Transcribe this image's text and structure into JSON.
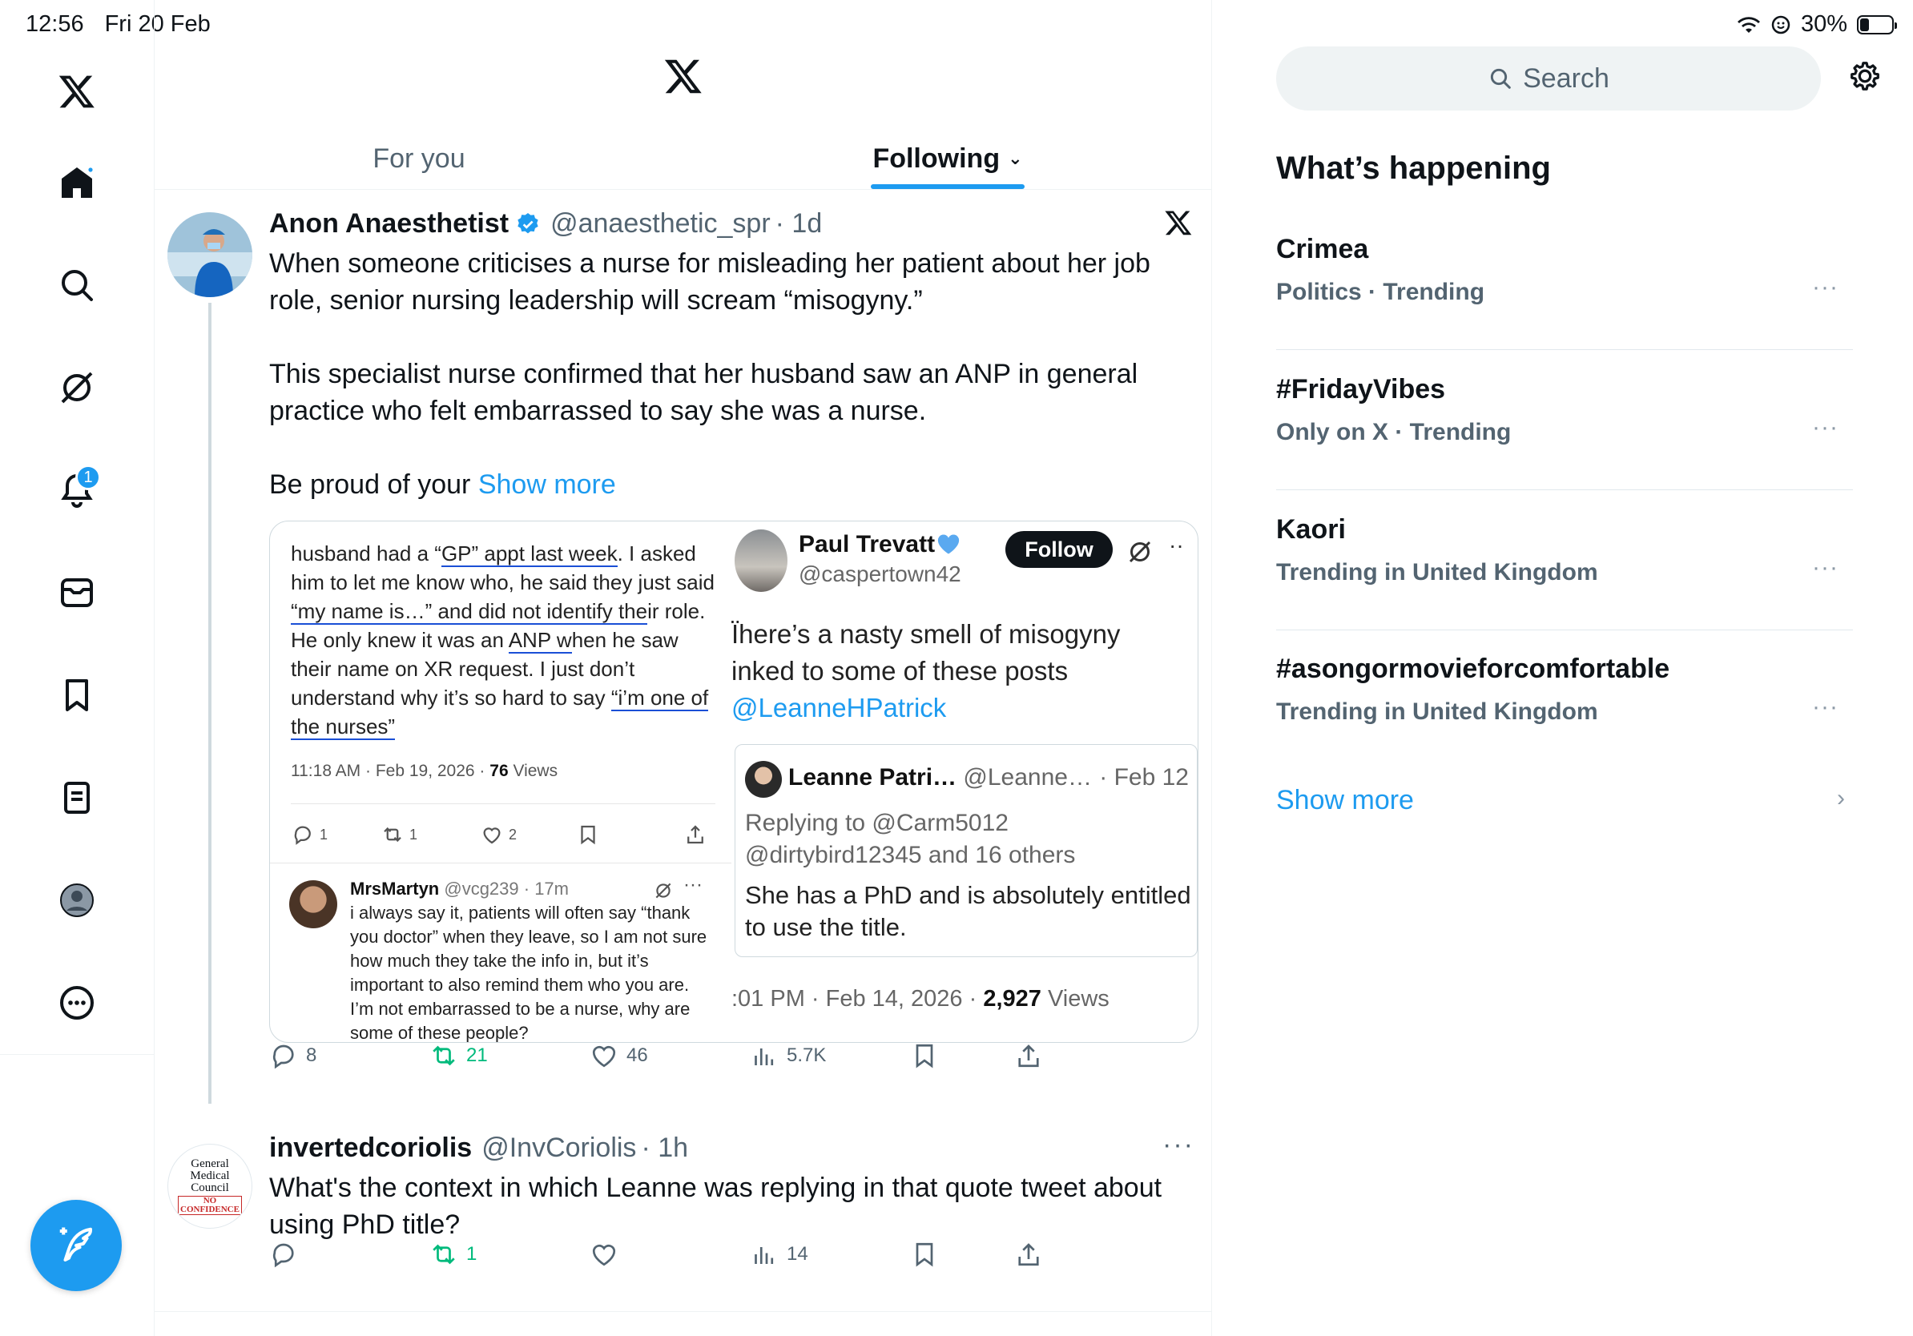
{
  "status_bar": {
    "time": "12:56",
    "date": "Fri 20 Feb",
    "battery": "30%"
  },
  "nav": {
    "notifications_badge": "1"
  },
  "tabs": [
    {
      "label": "For you",
      "active": false
    },
    {
      "label": "Following",
      "active": true
    }
  ],
  "tweet1": {
    "name": "Anon Anaesthetist",
    "handle": "@anaesthetic_spr",
    "time": "· 1d",
    "text": "When someone criticises a nurse for misleading her patient about her job role, senior nursing leadership will scream “misogyny.”\n\nThis specialist nurse confirmed that her husband saw an ANP in general practice who felt embarrassed to say she was a nurse.\n\nBe proud of your ",
    "show_more": "Show more",
    "media": {
      "left": {
        "p1": "husband had a “",
        "u1": "GP” appt last week",
        "p2": ". I asked him to let me know who, he said they just said ",
        "u2": "“my name is…” and did not identify the",
        "p3": "ir role. He only knew it was an ",
        "u3": "ANP w",
        "p4": "hen he saw their name on XR request. I just don’t understand why it’s so hard to say ",
        "u4": "“i’m one of the nurses”",
        "meta_time": "11:18 AM · Feb 19, 2026 · ",
        "meta_views_num": "76",
        "meta_views_label": " Views",
        "reply_count": "1",
        "repost_count": "1",
        "like_count": "2",
        "reply_name": "MrsMartyn",
        "reply_handle": " @vcg239 · 17m",
        "reply_text": "i always say it, patients will often say “thank you doctor” when they leave, so I am not sure how much they take the info in, but it’s important to also remind them who you are. I’m not embarrassed to be a nurse, why are some of these people?"
      },
      "right": {
        "name": "Paul Trevatt",
        "handle": "@caspertown42",
        "follow": "Follow",
        "text_a": "Ϊhere’s a nasty smell of misogyny",
        "text_b": "inked to some of these posts",
        "text_c": "@LeanneHPatrick",
        "quote_name": "Leanne Patri…",
        "quote_handle": " @Leanne…",
        "quote_date": "· Feb 12",
        "quote_reply_a": "Replying to @Carm5012",
        "quote_reply_b": "@dirtybird12345 and 16 others",
        "quote_text": "She has a PhD and is absolutely entitled to use the title.",
        "meta_time": ":01 PM · Feb 14, 2026 · ",
        "meta_views_num": "2,927",
        "meta_views_label": " Views"
      }
    },
    "replies": "8",
    "reposts": "21",
    "likes": "46",
    "views": "5.7K"
  },
  "tweet2": {
    "name": "invertedcoriolis",
    "handle": "@InvCoriolis",
    "time": "· 1h",
    "text": "What's the context in which Leanne was replying in that quote tweet about using PhD title?",
    "avatar_lines": [
      "General",
      "Medical",
      "Council",
      "NO",
      "CONFIDENCE"
    ],
    "reposts": "1",
    "views": "14"
  },
  "search": {
    "placeholder": "Search"
  },
  "whats_happening": {
    "title": "What’s happening",
    "trends": [
      {
        "name": "Crimea",
        "meta": "Politics · Trending"
      },
      {
        "name": "#FridayVibes",
        "meta": "Only on X · Trending"
      },
      {
        "name": "Kaori",
        "meta": "Trending in United Kingdom"
      },
      {
        "name": "#asongormovieforcomfortable",
        "meta": "Trending in United Kingdom"
      }
    ],
    "show_more": "Show more"
  }
}
